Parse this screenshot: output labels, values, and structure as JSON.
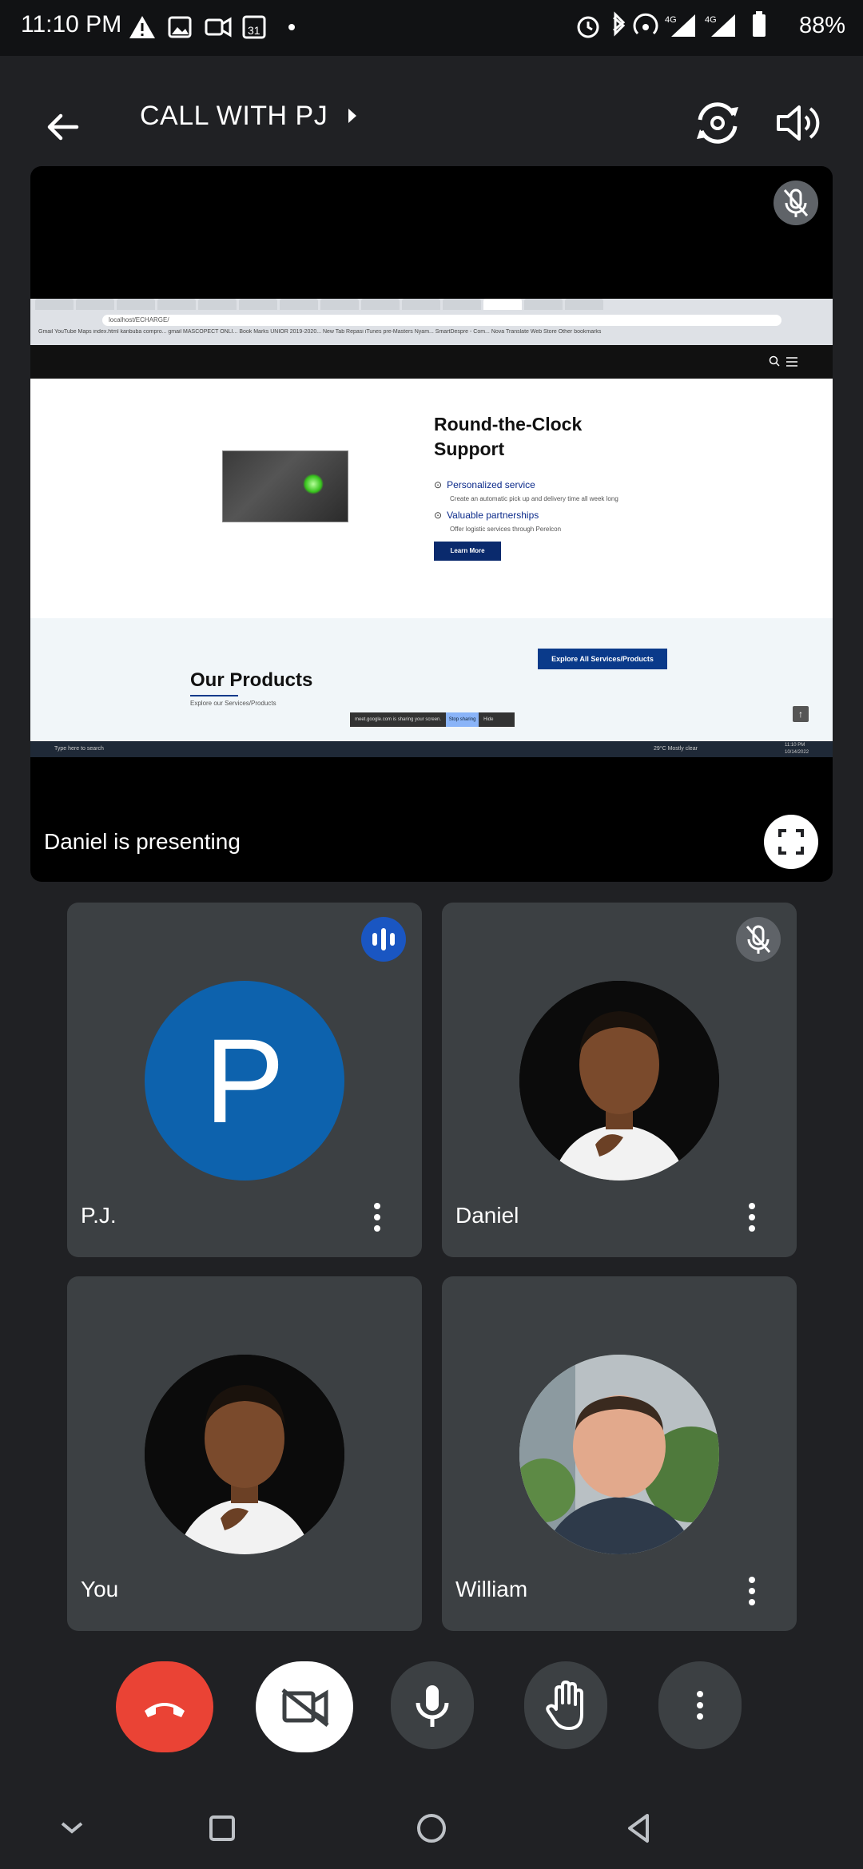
{
  "status_bar": {
    "time": "11:10 PM",
    "battery": "88%",
    "network": "4G",
    "icons": [
      "alert-icon",
      "image-icon",
      "video-icon",
      "calendar-icon",
      "dot-icon",
      "alarm-icon",
      "bluetooth-icon",
      "hotspot-icon",
      "signal-icon",
      "signal-icon",
      "battery-icon"
    ],
    "calendar_day": "31"
  },
  "top_bar": {
    "title": "CALL WITH PJ",
    "back_icon": "back-arrow-icon",
    "switch_camera_icon": "switch-camera-icon",
    "speaker_icon": "speaker-icon"
  },
  "presentation": {
    "label": "Daniel is presenting",
    "shared_screen": {
      "url": "localhost/ECHARGE/",
      "bookmarks": "Gmail  YouTube  Maps  index.html  kanbuba compro...  gmail  MASCOPECT ONLI...  Book Marks  UNIOR 2019-2020...  New Tab  Repasi  iTunes  pre-Masters Nyam...  SmartDespre - Com...  Nova  Translate  Web Store   Other bookmarks",
      "heading_line1": "Round-the-Clock",
      "heading_line2": "Support",
      "feature1_title": "Personalized service",
      "feature1_sub": "Create an automatic pick up and delivery time all week long",
      "feature2_title": "Valuable partnerships",
      "feature2_sub": "Offer logistic services through Perelcon",
      "learn_more": "Learn More",
      "products_title": "Our Products",
      "products_sub": "Explore our Services/Products",
      "explore_button": "Explore All Services/Products",
      "share_notice": "meet.google.com is sharing your screen.",
      "stop_sharing": "Stop sharing",
      "hide": "Hide",
      "taskbar_search": "Type here to search",
      "weather": "29°C  Mostly clear",
      "clock": "11:10 PM",
      "date": "10/14/2022"
    }
  },
  "participants": [
    {
      "name": "P.J.",
      "initial": "P",
      "status": "speaking"
    },
    {
      "name": "Daniel",
      "status": "muted"
    },
    {
      "name": "You"
    },
    {
      "name": "William"
    }
  ],
  "controls": {
    "end_call": "end-call-icon",
    "camera": "camera-off-icon",
    "mic": "mic-icon",
    "raise_hand": "raise-hand-icon",
    "more": "more-vert-icon"
  },
  "colors": {
    "end_call": "#ea4335",
    "pj_avatar": "#0d62ad",
    "speaking_badge": "#1a56c2",
    "tile_bg": "#3c4043"
  }
}
